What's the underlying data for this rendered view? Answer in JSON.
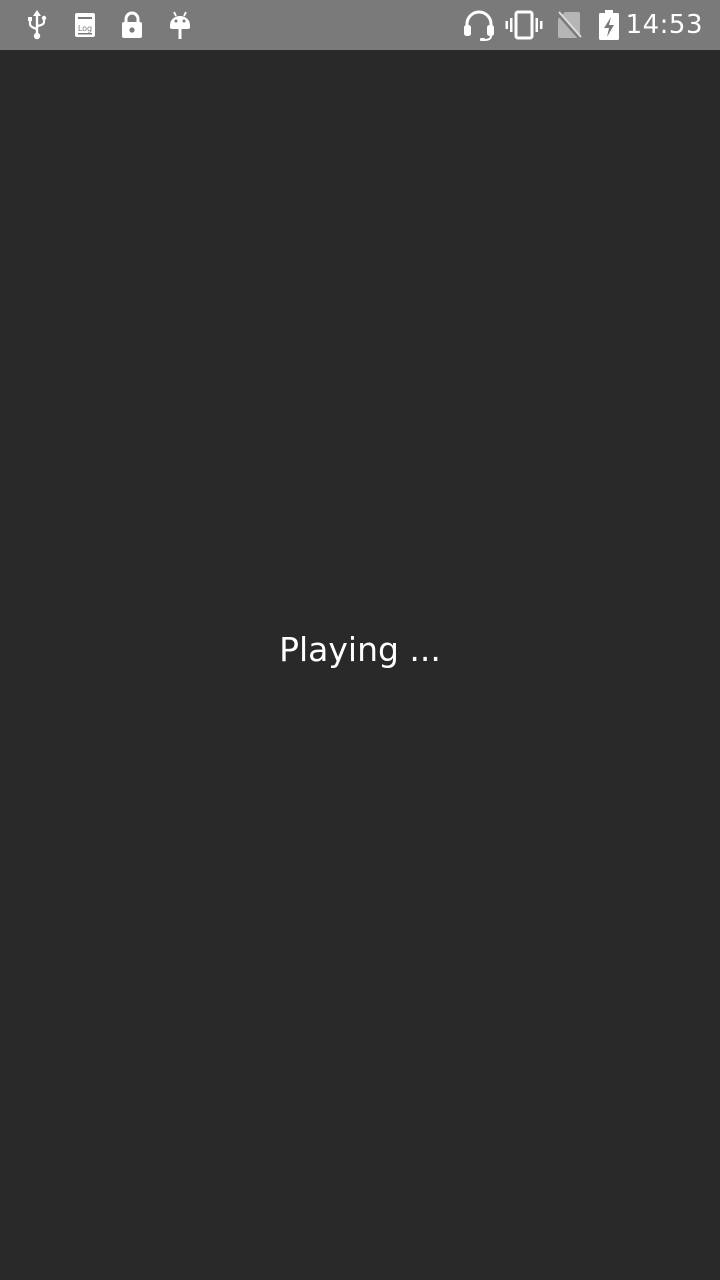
{
  "status_bar": {
    "time": "14:53",
    "left_icons": [
      "usb-icon",
      "log-icon",
      "lock-icon",
      "android-debug-icon"
    ],
    "right_icons": [
      "headset-icon",
      "vibrate-icon",
      "no-sim-icon",
      "battery-charging-icon"
    ],
    "background": "#7a7a7a"
  },
  "main": {
    "message": "Playing ...",
    "background": "#292929",
    "text_color": "#ffffff"
  }
}
